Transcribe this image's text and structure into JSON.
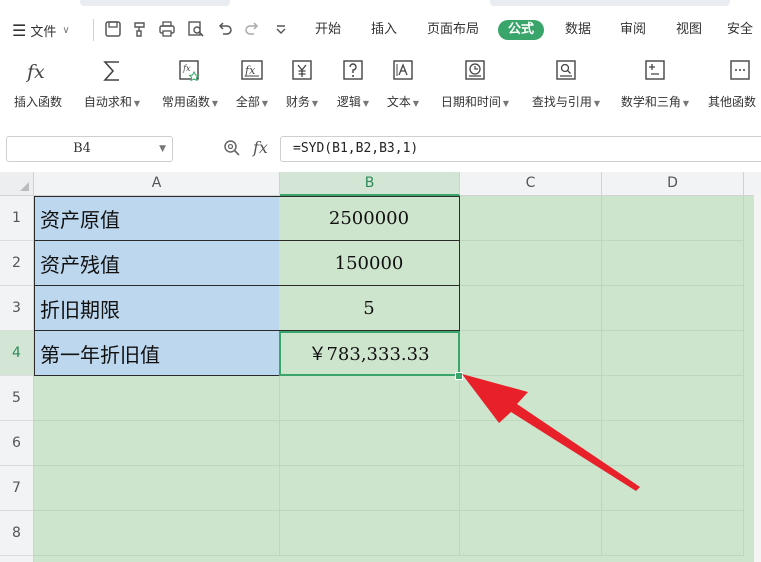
{
  "menu": {
    "file_label": "文件",
    "tabs": [
      "开始",
      "插入",
      "页面布局",
      "公式",
      "数据",
      "审阅",
      "视图",
      "安全"
    ],
    "active_tab": "公式"
  },
  "ribbon": {
    "items": [
      {
        "label": "插入函数",
        "icon": "fx-icon",
        "dropdown": false
      },
      {
        "label": "自动求和",
        "icon": "sigma-icon",
        "dropdown": true
      },
      {
        "label": "常用函数",
        "icon": "star-function-icon",
        "dropdown": true
      },
      {
        "label": "全部",
        "icon": "function-box-icon",
        "dropdown": true
      },
      {
        "label": "财务",
        "icon": "yen-icon",
        "dropdown": true
      },
      {
        "label": "逻辑",
        "icon": "question-box-icon",
        "dropdown": true
      },
      {
        "label": "文本",
        "icon": "text-box-icon",
        "dropdown": true
      },
      {
        "label": "日期和时间",
        "icon": "clock-icon",
        "dropdown": true
      },
      {
        "label": "查找与引用",
        "icon": "lookup-icon",
        "dropdown": true
      },
      {
        "label": "数学和三角",
        "icon": "math-icon",
        "dropdown": true
      },
      {
        "label": "其他函数",
        "icon": "more-functions-icon",
        "dropdown": false
      }
    ]
  },
  "formula_bar": {
    "name_box": "B4",
    "fx_label": "fx",
    "formula": "=SYD(B1,B2,B3,1)"
  },
  "sheet": {
    "columns": [
      "A",
      "B",
      "C",
      "D"
    ],
    "selected_column": "B",
    "rows": [
      "1",
      "2",
      "3",
      "4",
      "5",
      "6",
      "7",
      "8"
    ],
    "selected_row": "4",
    "cells": [
      {
        "label": "资产原值",
        "value": "2500000"
      },
      {
        "label": "资产残值",
        "value": "150000"
      },
      {
        "label": "折旧期限",
        "value": "5"
      },
      {
        "label": "第一年折旧值",
        "value": "￥783,333.33"
      }
    ],
    "active_cell": "B4"
  },
  "colors": {
    "accent": "#3aa56a",
    "label_cell_bg": "#bdd7ee",
    "sheet_bg": "#cde5cd",
    "arrow": "#e8202a"
  }
}
